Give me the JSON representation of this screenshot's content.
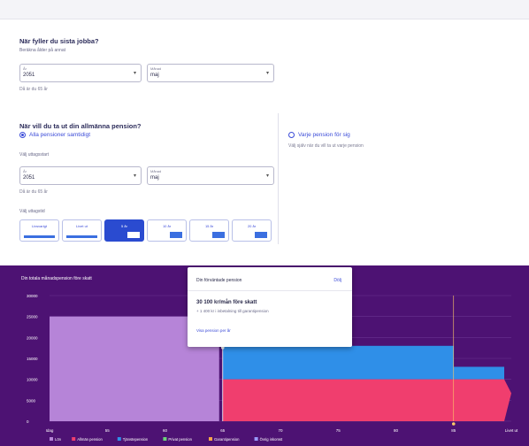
{
  "form": {
    "q1": {
      "title": "När fyller du sista jobba?",
      "help": "Beräkna ålder på annat",
      "year_label": "År",
      "year_value": "2051",
      "month_label": "Månad",
      "month_value": "maj",
      "hint": "Då är du 65 år"
    },
    "q2": {
      "title": "När vill du ta ut din allmänna pension?",
      "radio_all": "Alla pensioner samtidigt",
      "radio_each": "Varje pension för sig",
      "radio_each_hint": "Välj själv när du vill ta ut varje pension",
      "start_label": "Välj uttagsstart",
      "year_label": "År",
      "year_value": "2051",
      "month_label": "Månad",
      "month_value": "maj",
      "hint": "Då är du 65 år",
      "period_label": "Välj uttagstid",
      "tiles": [
        "Livsvarigt",
        "Livet ut",
        "5 år",
        "10 år",
        "15 år",
        "20 år"
      ]
    }
  },
  "popup": {
    "title": "Din förväntade pension",
    "action": "Dölj",
    "amount": "30 100 kr/mån före skatt",
    "sub": "+ 1 400 kr i inbetalning till garantipension",
    "note": "Visa pension per år"
  },
  "chart_data": {
    "type": "area",
    "title": "Din totala månadspension före skatt",
    "x_ticks": [
      "Idag",
      "55",
      "60",
      "65",
      "70",
      "75",
      "80",
      "85",
      "Livet ut"
    ],
    "y_ticks": [
      "0",
      "5000",
      "10000",
      "15000",
      "20000",
      "25000",
      "30000"
    ],
    "ylim": [
      0,
      30000
    ],
    "series": [
      {
        "name": "Lön",
        "color": "#b684d8",
        "x": [
          "Idag",
          "65"
        ],
        "values": [
          25000,
          25000
        ]
      },
      {
        "name": "Allmän pension",
        "color": "#f03e6e",
        "x": [
          "65",
          "Livet ut"
        ],
        "values": [
          10000,
          10000
        ]
      },
      {
        "name": "Tjänstepension",
        "color": "#2f8fe8",
        "x": [
          "65",
          "85"
        ],
        "values": [
          8000,
          8000
        ]
      }
    ],
    "legend": [
      "Lön",
      "Allmän pension",
      "Tjänstepension",
      "Privat pension",
      "Garantipension",
      "Övrig inkomst"
    ]
  }
}
